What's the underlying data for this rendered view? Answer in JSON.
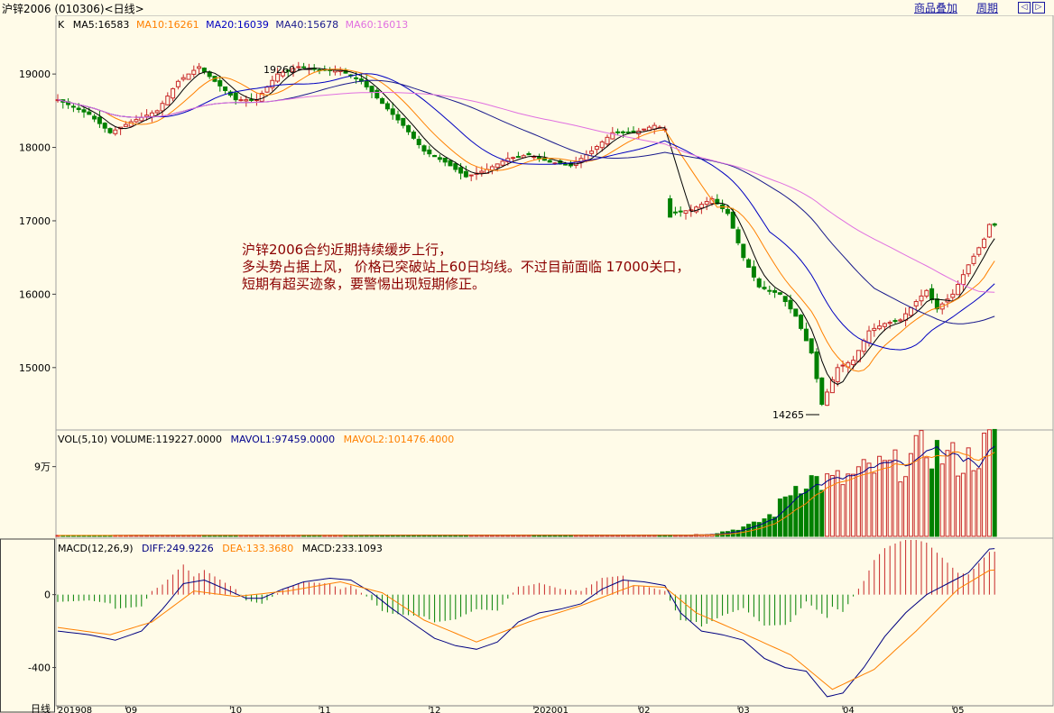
{
  "window": {
    "title": "沪锌2006 (010306)<日线>",
    "link_overlay": "商品叠加",
    "link_period": "周期",
    "btn_prev": "◁",
    "btn_next": "▷"
  },
  "colors": {
    "background": "#fffbe8",
    "up": "#c82828",
    "down": "#008000",
    "ma5": "#000000",
    "ma10": "#ff8000",
    "ma20": "#0000c0",
    "ma40": "#1a1a8c",
    "ma60": "#e070e0",
    "vol_mavol1": "#00008b",
    "vol_mavol2": "#ff8000",
    "diff": "#000080",
    "dea": "#ff8000",
    "grid": "#c8c8c8"
  },
  "price_panel": {
    "legend": {
      "k": "K",
      "ma5": "MA5:16583",
      "ma10": "MA10:16261",
      "ma20": "MA20:16039",
      "ma40": "MA40:15678",
      "ma60": "MA60:16013"
    },
    "high_label": "19260",
    "low_label": "14265"
  },
  "volume_panel": {
    "legend": {
      "label": "VOL(5,10) VOLUME:119227.0000",
      "mavol1": "MAVOL1:97459.0000",
      "mavol2": "MAVOL2:101476.4000"
    }
  },
  "macd_panel": {
    "legend": {
      "label": "MACD(12,26,9)",
      "diff": "DIFF:249.9226",
      "dea": "DEA:133.3680",
      "macd": "MACD:233.1093"
    }
  },
  "x_axis": {
    "corner": "日线",
    "labels": [
      "201908",
      "09",
      "10",
      "11",
      "12",
      "202001",
      "02",
      "03",
      "04",
      "05"
    ]
  },
  "annotation": {
    "line1": "沪锌2006合约近期持续缓步上行，",
    "line2": "多头势占据上风， 价格已突破站上60日均线。不过目前面临 17000关口，",
    "line3": "短期有超买迹象，要警惕出现短期修正。"
  },
  "chart_data": [
    {
      "type": "line",
      "title": "沪锌2006 (010306)<日线>",
      "description_kind": "candlestick",
      "y_ticks": [
        15000,
        16000,
        17000,
        18000,
        19000
      ],
      "y_tick_labels": [
        "15000",
        "16000",
        "17000",
        "18000",
        "19000"
      ],
      "ylim": [
        14150,
        19800
      ],
      "grid": false,
      "anchors": [
        [
          0,
          18650
        ],
        [
          6,
          18450
        ],
        [
          10,
          18200
        ],
        [
          14,
          18350
        ],
        [
          19,
          18500
        ],
        [
          23,
          18900
        ],
        [
          27,
          19100
        ],
        [
          30,
          18900
        ],
        [
          34,
          18650
        ],
        [
          38,
          18650
        ],
        [
          42,
          19000
        ],
        [
          46,
          19100
        ],
        [
          50,
          19050
        ],
        [
          54,
          19050
        ],
        [
          58,
          18900
        ],
        [
          62,
          18600
        ],
        [
          66,
          18300
        ],
        [
          70,
          17950
        ],
        [
          74,
          17800
        ],
        [
          78,
          17600
        ],
        [
          82,
          17700
        ],
        [
          86,
          17850
        ],
        [
          90,
          17900
        ],
        [
          94,
          17800
        ],
        [
          98,
          17750
        ],
        [
          102,
          17950
        ],
        [
          106,
          18200
        ],
        [
          110,
          18200
        ],
        [
          114,
          18300
        ],
        [
          116,
          18250
        ],
        [
          117,
          17100
        ],
        [
          121,
          17150
        ],
        [
          125,
          17300
        ],
        [
          128,
          17100
        ],
        [
          131,
          16500
        ],
        [
          134,
          16100
        ],
        [
          138,
          16000
        ],
        [
          141,
          15700
        ],
        [
          144,
          15200
        ],
        [
          146,
          14500
        ],
        [
          149,
          15000
        ],
        [
          152,
          15100
        ],
        [
          155,
          15500
        ],
        [
          158,
          15600
        ],
        [
          161,
          15650
        ],
        [
          164,
          15900
        ],
        [
          166,
          16050
        ],
        [
          168,
          15800
        ],
        [
          171,
          16000
        ],
        [
          174,
          16400
        ],
        [
          177,
          16750
        ],
        [
          178,
          16950
        ]
      ],
      "series": [
        {
          "name": "MA5",
          "value_last": 16583
        },
        {
          "name": "MA10",
          "value_last": 16261
        },
        {
          "name": "MA20",
          "value_last": 16039
        },
        {
          "name": "MA40",
          "value_last": 15678
        },
        {
          "name": "MA60",
          "value_last": 16013
        }
      ],
      "extremes": {
        "high": 19260,
        "low": 14265
      }
    },
    {
      "type": "bar",
      "title": "VOL(5,10)",
      "y_ticks": [
        90000
      ],
      "y_tick_labels": [
        "9万"
      ],
      "ylim": [
        0,
        135000
      ],
      "anchors": [
        [
          0,
          1200
        ],
        [
          120,
          1500
        ],
        [
          125,
          3000
        ],
        [
          129,
          8000
        ],
        [
          133,
          15000
        ],
        [
          137,
          30000
        ],
        [
          140,
          60000
        ],
        [
          143,
          75000
        ],
        [
          146,
          70000
        ],
        [
          150,
          72000
        ],
        [
          155,
          85000
        ],
        [
          160,
          90000
        ],
        [
          163,
          100000
        ],
        [
          166,
          115000
        ],
        [
          169,
          105000
        ],
        [
          173,
          95000
        ],
        [
          176,
          108000
        ],
        [
          178,
          119227
        ]
      ],
      "series": [
        {
          "name": "VOLUME",
          "value_last": 119227
        },
        {
          "name": "MAVOL1",
          "value_last": 97459
        },
        {
          "name": "MAVOL2",
          "value_last": 101476.4
        }
      ]
    },
    {
      "type": "line",
      "title": "MACD(12,26,9)",
      "y_ticks": [
        0,
        -400
      ],
      "y_tick_labels": [
        "0",
        "-400"
      ],
      "ylim": [
        -600,
        300
      ],
      "anchors_diff": [
        [
          0,
          -200
        ],
        [
          6,
          -220
        ],
        [
          11,
          -250
        ],
        [
          16,
          -200
        ],
        [
          20,
          -80
        ],
        [
          24,
          60
        ],
        [
          28,
          80
        ],
        [
          32,
          30
        ],
        [
          36,
          -20
        ],
        [
          39,
          -20
        ],
        [
          43,
          30
        ],
        [
          47,
          70
        ],
        [
          52,
          90
        ],
        [
          56,
          80
        ],
        [
          60,
          10
        ],
        [
          64,
          -80
        ],
        [
          68,
          -160
        ],
        [
          72,
          -240
        ],
        [
          76,
          -280
        ],
        [
          80,
          -300
        ],
        [
          84,
          -260
        ],
        [
          88,
          -150
        ],
        [
          92,
          -100
        ],
        [
          96,
          -80
        ],
        [
          100,
          -50
        ],
        [
          104,
          30
        ],
        [
          108,
          80
        ],
        [
          112,
          70
        ],
        [
          116,
          50
        ],
        [
          119,
          -100
        ],
        [
          123,
          -200
        ],
        [
          127,
          -220
        ],
        [
          131,
          -250
        ],
        [
          135,
          -350
        ],
        [
          139,
          -400
        ],
        [
          143,
          -420
        ],
        [
          147,
          -560
        ],
        [
          150,
          -540
        ],
        [
          154,
          -400
        ],
        [
          158,
          -230
        ],
        [
          162,
          -100
        ],
        [
          166,
          0
        ],
        [
          170,
          60
        ],
        [
          174,
          120
        ],
        [
          178,
          250
        ]
      ],
      "anchors_dea": [
        [
          0,
          -180
        ],
        [
          10,
          -220
        ],
        [
          18,
          -150
        ],
        [
          26,
          20
        ],
        [
          34,
          -10
        ],
        [
          44,
          20
        ],
        [
          54,
          70
        ],
        [
          62,
          10
        ],
        [
          70,
          -140
        ],
        [
          80,
          -260
        ],
        [
          90,
          -150
        ],
        [
          100,
          -60
        ],
        [
          110,
          50
        ],
        [
          116,
          40
        ],
        [
          122,
          -100
        ],
        [
          130,
          -200
        ],
        [
          140,
          -330
        ],
        [
          148,
          -520
        ],
        [
          156,
          -410
        ],
        [
          164,
          -200
        ],
        [
          172,
          30
        ],
        [
          178,
          133
        ]
      ],
      "series": [
        {
          "name": "DIFF",
          "value_last": 249.9226
        },
        {
          "name": "DEA",
          "value_last": 133.368
        },
        {
          "name": "MACD",
          "value_last": 233.1093
        }
      ]
    }
  ]
}
